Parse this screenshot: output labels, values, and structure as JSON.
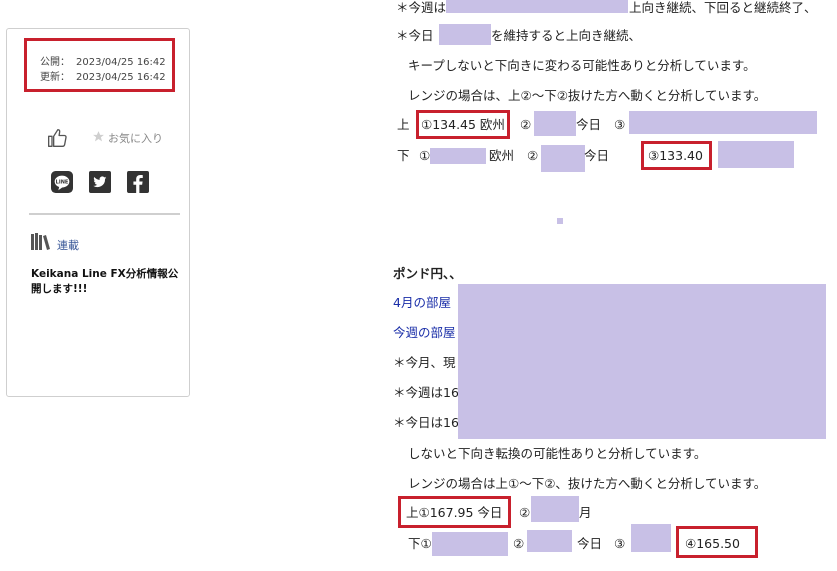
{
  "sidebar": {
    "published_label": "公開：",
    "published_date": "2023/04/25 16:42",
    "updated_label": "更新：",
    "updated_date": "2023/04/25 16:42",
    "favorite_label": "お気に入り",
    "share_icons": [
      "line-icon",
      "twitter-icon",
      "facebook-icon"
    ],
    "series_label": "連載",
    "series_title": "Keikana Line FX分析情報公開します!!!"
  },
  "article": {
    "lines": {
      "l1a": "＊今週は",
      "l1b": "上向き継続、下回ると継続終了、",
      "l2a": "＊今日",
      "l2b": "を維持すると上向き継続、",
      "l3": "キープしないと下向きに変わる可能性ありと分析しています。",
      "l4": "レンジの場合は、上②～下②抜けた方へ動くと分析しています。",
      "up_label": "上",
      "up1": "①134.45 欧州",
      "up2": "②",
      "up2b": "今日",
      "up3": "③",
      "down_label": "下",
      "down1": "①",
      "down1b": "欧州",
      "down2": "②",
      "down2b": "今日",
      "down3": "③133.40",
      "gbp_heading": "ポンド円、、",
      "month_room": "4月の部屋",
      "week_room": "今週の部屋",
      "l9": "＊今月、現",
      "l10": "＊今週は16",
      "l11": "＊今日は16",
      "l12": "しないと下向き転換の可能性ありと分析しています。",
      "l13": "レンジの場合は上①～下②、抜けた方へ動くと分析しています。",
      "gup1": "上①167.95 今日",
      "gup2": "②",
      "gup2b": "月",
      "gdown1": "下①",
      "gdown2": "②",
      "gdown2b": "今日",
      "gdown3": "③",
      "gdown4": "④165.50"
    }
  },
  "colors": {
    "redaction": "#c8c0e6",
    "highlight_border": "#c8202d",
    "link": "#1a2ea8"
  }
}
